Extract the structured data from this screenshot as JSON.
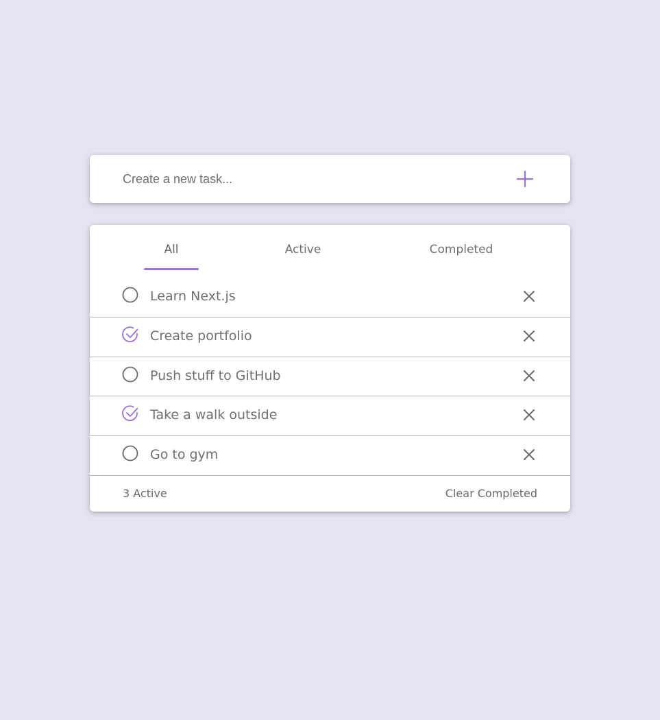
{
  "new_task": {
    "placeholder": "Create a new task...",
    "add_icon": "plus-icon"
  },
  "filters": {
    "tabs": [
      {
        "label": "All",
        "selected": true
      },
      {
        "label": "Active",
        "selected": false
      },
      {
        "label": "Completed",
        "selected": false
      }
    ]
  },
  "tasks": [
    {
      "title": "Learn Next.js",
      "completed": false
    },
    {
      "title": "Create portfolio",
      "completed": true
    },
    {
      "title": "Push stuff to GitHub",
      "completed": false
    },
    {
      "title": "Take a walk outside",
      "completed": true
    },
    {
      "title": "Go to gym",
      "completed": false
    }
  ],
  "footer": {
    "active_count": "3 Active",
    "clear_label": "Clear Completed"
  },
  "colors": {
    "background": "#e4e4f0",
    "accent": "#9a72d8",
    "text": "#707070",
    "card": "#ffffff",
    "divider": "#b5b5b5"
  }
}
